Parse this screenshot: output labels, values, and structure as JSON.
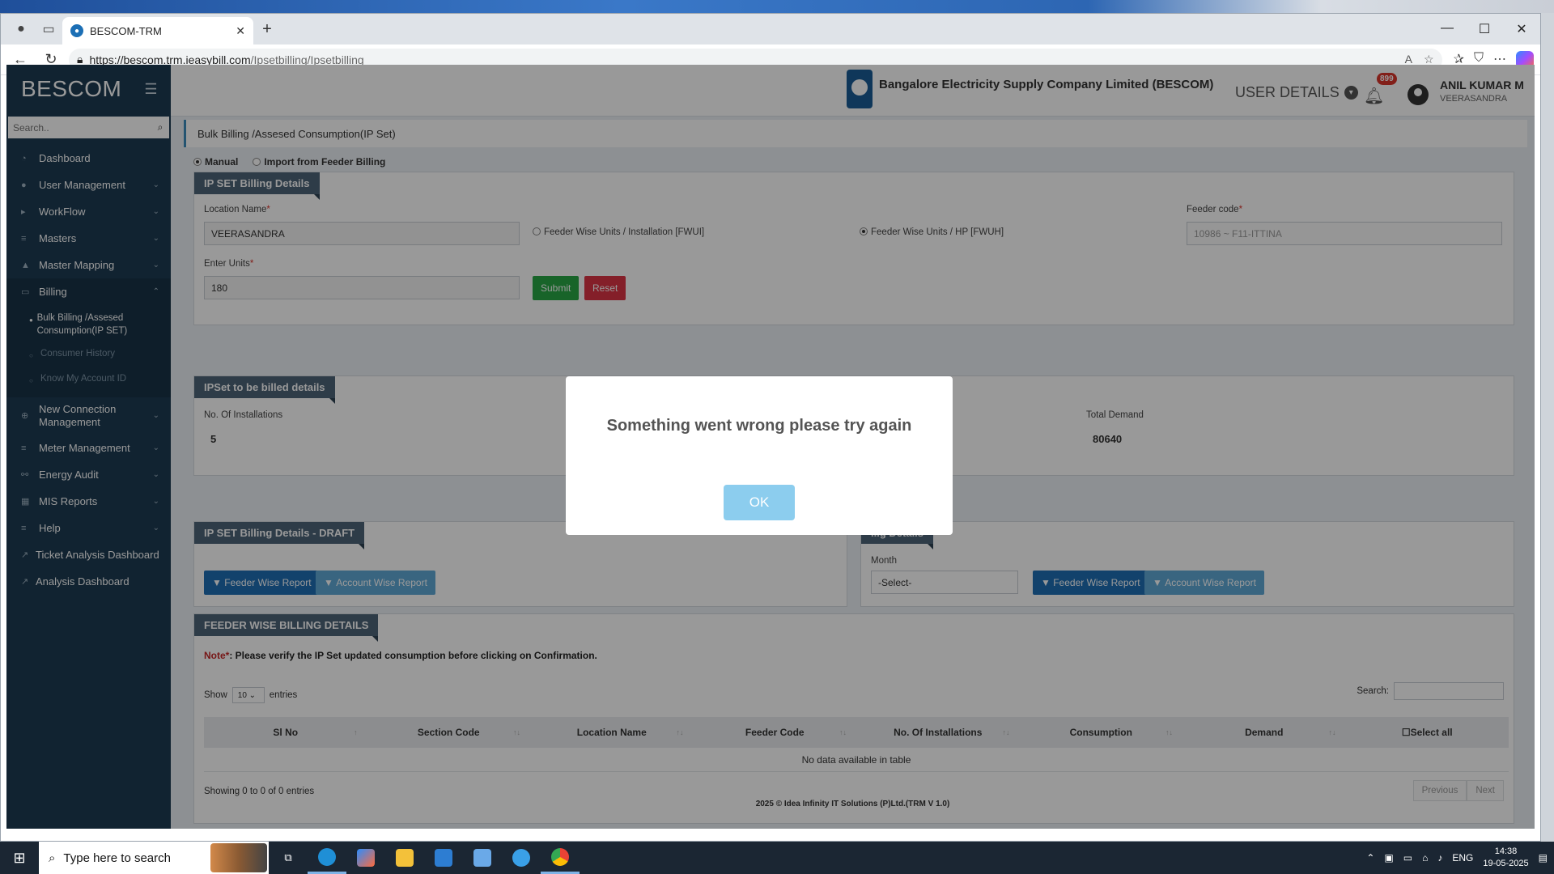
{
  "browser": {
    "tab_title": "BESCOM-TRM",
    "url_host": "https://bescom.trm.ieasybill.com",
    "url_path": "/Ipsetbilling/Ipsetbilling"
  },
  "sidebar": {
    "brand": "BESCOM",
    "search_placeholder": "Search..",
    "items": [
      {
        "label": "Dashboard",
        "icon": "dashboard-icon"
      },
      {
        "label": "User Management",
        "icon": "user-icon"
      },
      {
        "label": "WorkFlow",
        "icon": "workflow-icon"
      },
      {
        "label": "Masters",
        "icon": "list-icon"
      },
      {
        "label": "Master Mapping",
        "icon": "mapping-icon"
      },
      {
        "label": "Billing",
        "icon": "monitor-icon"
      },
      {
        "label": "New Connection Management",
        "icon": "plug-icon"
      },
      {
        "label": "Meter Management",
        "icon": "list-icon"
      },
      {
        "label": "Energy Audit",
        "icon": "audit-icon"
      },
      {
        "label": "MIS Reports",
        "icon": "report-icon"
      },
      {
        "label": "Help",
        "icon": "help-icon"
      },
      {
        "label": "Ticket Analysis Dashboard",
        "icon": "chart-icon"
      },
      {
        "label": "Analysis Dashboard",
        "icon": "chart-icon"
      }
    ],
    "billing_sub": [
      {
        "label": "Bulk Billing /Assesed Consumption(IP SET)"
      },
      {
        "label": "Consumer History"
      },
      {
        "label": "Know My Account ID"
      }
    ]
  },
  "header": {
    "company": "Bangalore Electricity Supply Company Limited (BESCOM)",
    "user_details": "USER DETAILS",
    "notification_count": "899",
    "user_name": "ANIL KUMAR M",
    "user_location": "VEERASANDRA"
  },
  "page": {
    "breadcrumb": "Bulk Billing /Assesed Consumption(IP Set)",
    "mode_manual": "Manual",
    "mode_import": "Import from Feeder Billing"
  },
  "billing_details": {
    "title": "IP SET Billing Details",
    "location_label": "Location Name",
    "location_value": "VEERASANDRA",
    "fwui_label": "Feeder Wise Units / Installation [FWUI]",
    "fwuh_label": "Feeder Wise Units / HP [FWUH]",
    "feeder_label": "Feeder code",
    "feeder_value": "10986 ~ F11-ITTINA",
    "units_label": "Enter Units",
    "units_value": "180",
    "submit": "Submit",
    "reset": "Reset"
  },
  "to_be_billed": {
    "title": "IPSet to be billed details",
    "installations_label": "No. Of Installations",
    "installations_value": "5",
    "demand_label": "Total Demand",
    "demand_value": "80640"
  },
  "draft": {
    "title": "IP SET Billing Details - DRAFT",
    "feeder_report": "Feeder Wise Report",
    "account_report": "Account Wise Report"
  },
  "right_panel": {
    "title_partial": "...g Details",
    "month_label": "Month",
    "month_value": "-Select-",
    "feeder_report": "Feeder Wise Report",
    "account_report": "Account Wise Report"
  },
  "feeder_billing": {
    "title": "FEEDER WISE BILLING DETAILS",
    "note_prefix": "Note",
    "note_marker": "*",
    "note_text": ": Please verify the IP Set updated consumption before clicking on Confirmation.",
    "show": "Show",
    "entries_value": "10",
    "entries": "entries",
    "search_label": "Search:",
    "columns": [
      "Sl No",
      "Section Code",
      "Location Name",
      "Feeder Code",
      "No. Of Installations",
      "Consumption",
      "Demand",
      "Select all"
    ],
    "empty": "No data available in table",
    "showing": "Showing 0 to 0 of 0 entries",
    "previous": "Previous",
    "next": "Next"
  },
  "footer": "2025 © Idea Infinity IT Solutions (P)Ltd.(TRM V 1.0)",
  "modal": {
    "message": "Something went wrong please try again",
    "ok": "OK"
  },
  "taskbar": {
    "search_placeholder": "Type here to search",
    "lang": "ENG",
    "time": "14:38",
    "date": "19-05-2025"
  }
}
